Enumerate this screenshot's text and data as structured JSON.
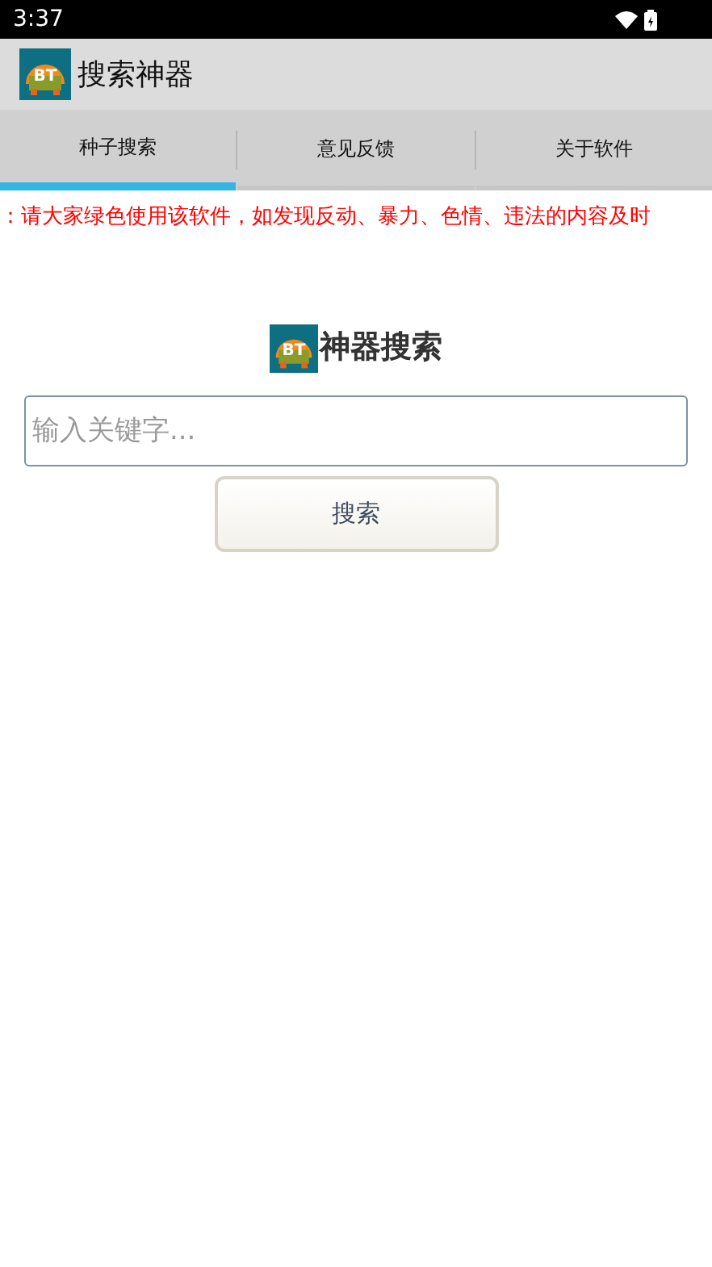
{
  "status_bar": {
    "time": "3:37"
  },
  "app_bar": {
    "logo_text": "BT",
    "title": "搜索神器"
  },
  "tabs": [
    {
      "label": "种子搜索",
      "selected": true
    },
    {
      "label": "意见反馈",
      "selected": false
    },
    {
      "label": "关于软件",
      "selected": false
    }
  ],
  "notice": "：请大家绿色使用该软件，如发现反动、暴力、色情、违法的内容及时",
  "heading": {
    "logo_text": "BT",
    "title": "神器搜索"
  },
  "search": {
    "placeholder": "输入关键字..."
  },
  "search_button": "搜索"
}
